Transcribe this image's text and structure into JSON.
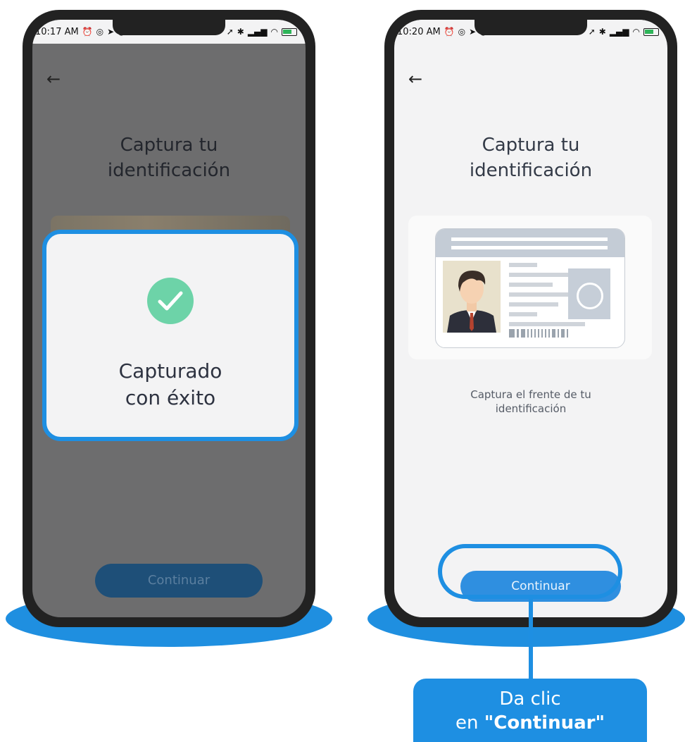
{
  "left_phone": {
    "status_time": "10:17 AM",
    "status_dots": "···",
    "title_line1": "Captura tu",
    "title_line2": "identificación",
    "modal": {
      "message_line1": "Capturado",
      "message_line2": "con éxito"
    },
    "button_label": "Continuar"
  },
  "right_phone": {
    "status_time": "10:20 AM",
    "status_dots": "···",
    "title_line1": "Captura tu",
    "title_line2": "identificación",
    "caption_line1": "Captura el frente de tu",
    "caption_line2": "identificación",
    "button_label": "Continuar"
  },
  "callout": {
    "line1": "Da clic",
    "line2_prefix": "en ",
    "line2_bold": "\"Continuar\""
  },
  "colors": {
    "accent": "#1e8fe2",
    "success": "#6dd3a8"
  }
}
